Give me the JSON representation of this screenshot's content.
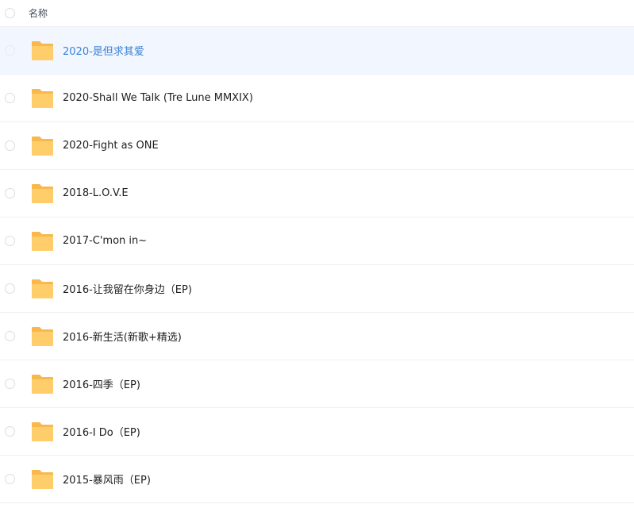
{
  "header": {
    "name_label": "名称"
  },
  "rows": [
    {
      "name": "2020-是但求其爱",
      "selected": true
    },
    {
      "name": "2020-Shall We Talk (Tre Lune MMXIX)",
      "selected": false
    },
    {
      "name": "2020-Fight as ONE",
      "selected": false
    },
    {
      "name": "2018-L.O.V.E",
      "selected": false
    },
    {
      "name": "2017-C'mon in~",
      "selected": false
    },
    {
      "name": "2016-让我留在你身边（EP)",
      "selected": false
    },
    {
      "name": "2016-新生活(新歌+精选)",
      "selected": false
    },
    {
      "name": "2016-四季（EP)",
      "selected": false
    },
    {
      "name": "2016-I Do（EP)",
      "selected": false
    },
    {
      "name": "2015-暴风雨（EP)",
      "selected": false
    }
  ],
  "colors": {
    "folder_back": "#f9b84d",
    "folder_front": "#ffcd6a",
    "selected_bg": "#f1f6ff",
    "selected_text": "#3b82d6"
  },
  "icons": {
    "row_icon": "folder-icon",
    "select_icon": "radio-circle-icon"
  }
}
